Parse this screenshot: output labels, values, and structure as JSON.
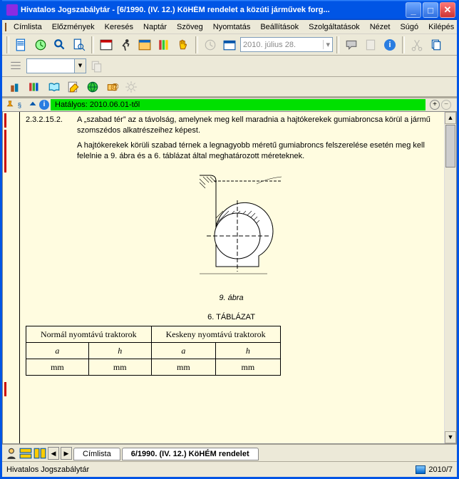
{
  "title": "Hivatalos Jogszabálytár - [6/1990. (IV. 12.) KöHÉM rendelet a közúti járművek forg...",
  "menu": [
    "Címlista",
    "Előzmények",
    "Keresés",
    "Naptár",
    "Szöveg",
    "Nyomtatás",
    "Beállítások",
    "Szolgáltatások",
    "Nézet",
    "Súgó",
    "Kilépés"
  ],
  "date_field": "2010. július 28.",
  "valid_label": "Hatályos: 2010.06.01-től",
  "doc": {
    "section_num": "2.3.2.15.2.",
    "para1": "A „szabad tér” az a távolság, amelynek meg kell maradnia a hajtókerekek gumiabroncsa körül a jármű szomszédos alkatrészeihez képest.",
    "para2": "A hajtókerekek körüli szabad térnek a legnagyobb méretű gumiabroncs felszerelése esetén meg kell felelnie a 9. ábra és a 6. táblázat által meghatározott méreteknek.",
    "fig_caption": "9. ábra",
    "table_title": "6. TÁBLÁZAT",
    "col_group1": "Normál nyomtávú traktorok",
    "col_group2": "Keskeny nyomtávú traktorok",
    "h_a": "a",
    "h_h": "h",
    "u_mm": "mm"
  },
  "tabs": {
    "t1": "Címlista",
    "t2": "6/1990. (IV. 12.) KöHÉM rendelet"
  },
  "status_left": "Hivatalos Jogszabálytár",
  "status_right": "2010/7"
}
